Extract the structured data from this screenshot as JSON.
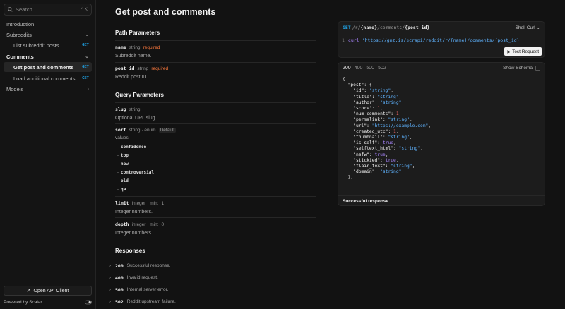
{
  "sidebar": {
    "search_placeholder": "Search",
    "search_shortcut": "^ K",
    "items": [
      {
        "label": "Introduction"
      },
      {
        "label": "Subreddits"
      },
      {
        "label": "List subreddit posts",
        "method": "GET"
      },
      {
        "label": "Comments"
      },
      {
        "label": "Get post and comments",
        "method": "GET"
      },
      {
        "label": "Load additional comments",
        "method": "GET"
      },
      {
        "label": "Models"
      }
    ],
    "open_api_label": "Open API Client",
    "powered_by": "Powered by Scalar"
  },
  "main": {
    "title": "Get post and comments",
    "path_params_title": "Path Parameters",
    "path_params": [
      {
        "name": "name",
        "type": "string",
        "required": "required",
        "description": "Subreddit name."
      },
      {
        "name": "post_id",
        "type": "string",
        "required": "required",
        "description": "Reddit post ID."
      }
    ],
    "query_params_title": "Query Parameters",
    "query_params": {
      "slug": {
        "name": "slug",
        "type": "string",
        "description": "Optional URL slug."
      },
      "sort": {
        "name": "sort",
        "type": "string · enum",
        "default": "Default",
        "values_label": "values",
        "values": [
          "confidence",
          "top",
          "new",
          "controversial",
          "old",
          "qa"
        ]
      },
      "limit": {
        "name": "limit",
        "type": "integer · min:",
        "min": "1",
        "description": "Integer numbers."
      },
      "depth": {
        "name": "depth",
        "type": "integer · min:",
        "min": "0",
        "description": "Integer numbers."
      }
    },
    "responses_title": "Responses",
    "responses": [
      {
        "code": "200",
        "description": "Successful response."
      },
      {
        "code": "400",
        "description": "Invalid request."
      },
      {
        "code": "500",
        "description": "Internal server error."
      },
      {
        "code": "502",
        "description": "Reddit upstream failure."
      }
    ]
  },
  "request": {
    "method": "GET",
    "path_parts": [
      "/r/",
      "{name}",
      "/comments/",
      "{post_id}"
    ],
    "client": "Shell Curl",
    "line_number": "1",
    "command": "curl",
    "url": "'https://gnz.is/scrapi/reddit/r/{name}/comments/{post_id}'",
    "test_label": "Test Request"
  },
  "response_panel": {
    "tabs": [
      "200",
      "400",
      "500",
      "502"
    ],
    "show_schema": "Show Schema",
    "footer": "Successful response.",
    "fields": [
      {
        "key": "id",
        "value": "\"string\"",
        "kind": "s"
      },
      {
        "key": "title",
        "value": "\"string\"",
        "kind": "s"
      },
      {
        "key": "author",
        "value": "\"string\"",
        "kind": "s"
      },
      {
        "key": "score",
        "value": "1",
        "kind": "n"
      },
      {
        "key": "num_comments",
        "value": "1",
        "kind": "n"
      },
      {
        "key": "permalink",
        "value": "\"string\"",
        "kind": "s"
      },
      {
        "key": "url",
        "value": "\"https://example.com\"",
        "kind": "s"
      },
      {
        "key": "created_utc",
        "value": "1",
        "kind": "n"
      },
      {
        "key": "thumbnail",
        "value": "\"string\"",
        "kind": "s"
      },
      {
        "key": "is_self",
        "value": "true",
        "kind": "b"
      },
      {
        "key": "selftext_html",
        "value": "\"string\"",
        "kind": "s"
      },
      {
        "key": "nsfw",
        "value": "true",
        "kind": "b"
      },
      {
        "key": "stickied",
        "value": "true",
        "kind": "b"
      },
      {
        "key": "flair_text",
        "value": "\"string\"",
        "kind": "s"
      },
      {
        "key": "domain",
        "value": "\"string\"",
        "kind": "s"
      }
    ]
  }
}
